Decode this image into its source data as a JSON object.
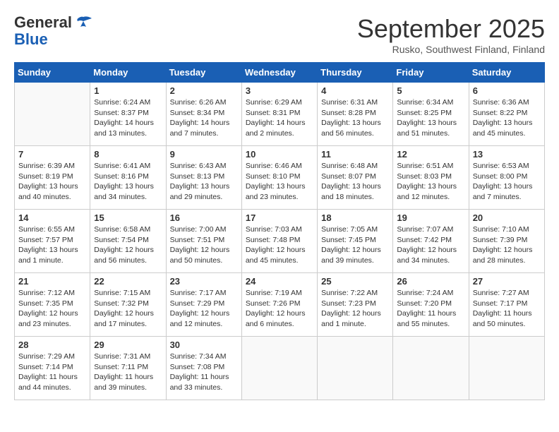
{
  "header": {
    "logo_general": "General",
    "logo_blue": "Blue",
    "month": "September 2025",
    "location": "Rusko, Southwest Finland, Finland"
  },
  "weekdays": [
    "Sunday",
    "Monday",
    "Tuesday",
    "Wednesday",
    "Thursday",
    "Friday",
    "Saturday"
  ],
  "weeks": [
    [
      {
        "day": "",
        "info": ""
      },
      {
        "day": "1",
        "info": "Sunrise: 6:24 AM\nSunset: 8:37 PM\nDaylight: 14 hours\nand 13 minutes."
      },
      {
        "day": "2",
        "info": "Sunrise: 6:26 AM\nSunset: 8:34 PM\nDaylight: 14 hours\nand 7 minutes."
      },
      {
        "day": "3",
        "info": "Sunrise: 6:29 AM\nSunset: 8:31 PM\nDaylight: 14 hours\nand 2 minutes."
      },
      {
        "day": "4",
        "info": "Sunrise: 6:31 AM\nSunset: 8:28 PM\nDaylight: 13 hours\nand 56 minutes."
      },
      {
        "day": "5",
        "info": "Sunrise: 6:34 AM\nSunset: 8:25 PM\nDaylight: 13 hours\nand 51 minutes."
      },
      {
        "day": "6",
        "info": "Sunrise: 6:36 AM\nSunset: 8:22 PM\nDaylight: 13 hours\nand 45 minutes."
      }
    ],
    [
      {
        "day": "7",
        "info": "Sunrise: 6:39 AM\nSunset: 8:19 PM\nDaylight: 13 hours\nand 40 minutes."
      },
      {
        "day": "8",
        "info": "Sunrise: 6:41 AM\nSunset: 8:16 PM\nDaylight: 13 hours\nand 34 minutes."
      },
      {
        "day": "9",
        "info": "Sunrise: 6:43 AM\nSunset: 8:13 PM\nDaylight: 13 hours\nand 29 minutes."
      },
      {
        "day": "10",
        "info": "Sunrise: 6:46 AM\nSunset: 8:10 PM\nDaylight: 13 hours\nand 23 minutes."
      },
      {
        "day": "11",
        "info": "Sunrise: 6:48 AM\nSunset: 8:07 PM\nDaylight: 13 hours\nand 18 minutes."
      },
      {
        "day": "12",
        "info": "Sunrise: 6:51 AM\nSunset: 8:03 PM\nDaylight: 13 hours\nand 12 minutes."
      },
      {
        "day": "13",
        "info": "Sunrise: 6:53 AM\nSunset: 8:00 PM\nDaylight: 13 hours\nand 7 minutes."
      }
    ],
    [
      {
        "day": "14",
        "info": "Sunrise: 6:55 AM\nSunset: 7:57 PM\nDaylight: 13 hours\nand 1 minute."
      },
      {
        "day": "15",
        "info": "Sunrise: 6:58 AM\nSunset: 7:54 PM\nDaylight: 12 hours\nand 56 minutes."
      },
      {
        "day": "16",
        "info": "Sunrise: 7:00 AM\nSunset: 7:51 PM\nDaylight: 12 hours\nand 50 minutes."
      },
      {
        "day": "17",
        "info": "Sunrise: 7:03 AM\nSunset: 7:48 PM\nDaylight: 12 hours\nand 45 minutes."
      },
      {
        "day": "18",
        "info": "Sunrise: 7:05 AM\nSunset: 7:45 PM\nDaylight: 12 hours\nand 39 minutes."
      },
      {
        "day": "19",
        "info": "Sunrise: 7:07 AM\nSunset: 7:42 PM\nDaylight: 12 hours\nand 34 minutes."
      },
      {
        "day": "20",
        "info": "Sunrise: 7:10 AM\nSunset: 7:39 PM\nDaylight: 12 hours\nand 28 minutes."
      }
    ],
    [
      {
        "day": "21",
        "info": "Sunrise: 7:12 AM\nSunset: 7:35 PM\nDaylight: 12 hours\nand 23 minutes."
      },
      {
        "day": "22",
        "info": "Sunrise: 7:15 AM\nSunset: 7:32 PM\nDaylight: 12 hours\nand 17 minutes."
      },
      {
        "day": "23",
        "info": "Sunrise: 7:17 AM\nSunset: 7:29 PM\nDaylight: 12 hours\nand 12 minutes."
      },
      {
        "day": "24",
        "info": "Sunrise: 7:19 AM\nSunset: 7:26 PM\nDaylight: 12 hours\nand 6 minutes."
      },
      {
        "day": "25",
        "info": "Sunrise: 7:22 AM\nSunset: 7:23 PM\nDaylight: 12 hours\nand 1 minute."
      },
      {
        "day": "26",
        "info": "Sunrise: 7:24 AM\nSunset: 7:20 PM\nDaylight: 11 hours\nand 55 minutes."
      },
      {
        "day": "27",
        "info": "Sunrise: 7:27 AM\nSunset: 7:17 PM\nDaylight: 11 hours\nand 50 minutes."
      }
    ],
    [
      {
        "day": "28",
        "info": "Sunrise: 7:29 AM\nSunset: 7:14 PM\nDaylight: 11 hours\nand 44 minutes."
      },
      {
        "day": "29",
        "info": "Sunrise: 7:31 AM\nSunset: 7:11 PM\nDaylight: 11 hours\nand 39 minutes."
      },
      {
        "day": "30",
        "info": "Sunrise: 7:34 AM\nSunset: 7:08 PM\nDaylight: 11 hours\nand 33 minutes."
      },
      {
        "day": "",
        "info": ""
      },
      {
        "day": "",
        "info": ""
      },
      {
        "day": "",
        "info": ""
      },
      {
        "day": "",
        "info": ""
      }
    ]
  ]
}
